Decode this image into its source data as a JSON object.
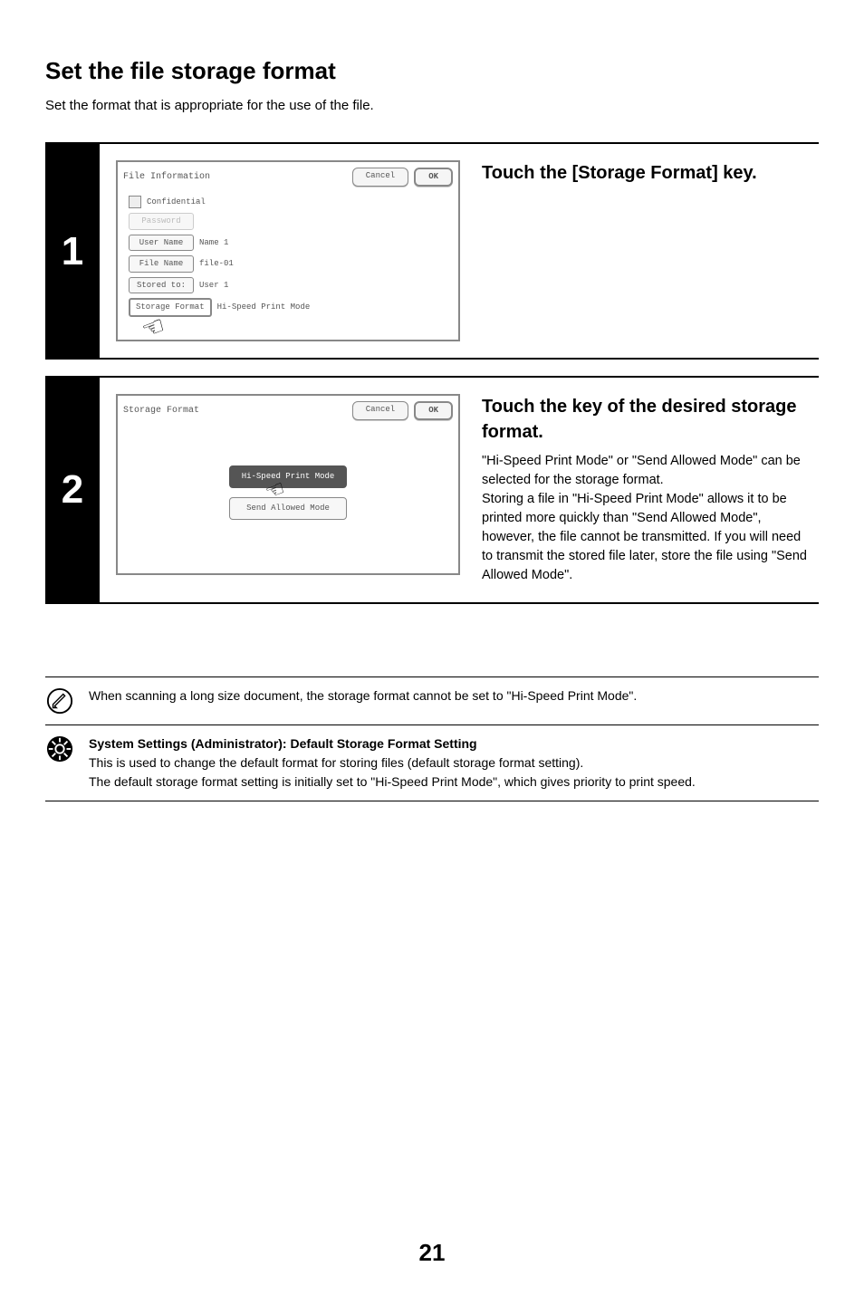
{
  "page": {
    "title": "Set the file storage format",
    "intro": "Set the format that is appropriate for the use of the file.",
    "number": "21"
  },
  "step1": {
    "num": "1",
    "heading": "Touch the [Storage Format] key.",
    "panel": {
      "title": "File Information",
      "cancel": "Cancel",
      "ok": "OK",
      "confidential": "Confidential",
      "password": "Password",
      "username_label": "User Name",
      "username_value": "Name 1",
      "filename_label": "File Name",
      "filename_value": "file-01",
      "storedto_label": "Stored to:",
      "storedto_value": "User 1",
      "storageformat_label": "Storage Format",
      "storageformat_value": "Hi-Speed Print Mode"
    }
  },
  "step2": {
    "num": "2",
    "heading": "Touch the key of the desired storage format.",
    "body": "\"Hi-Speed Print Mode\" or \"Send Allowed Mode\" can be selected for the storage format.\nStoring a file in \"Hi-Speed Print Mode\" allows it to be printed more quickly than \"Send Allowed Mode\", however, the file cannot be transmitted. If you will need to transmit the stored file later, store the file using \"Send Allowed Mode\".",
    "panel": {
      "title": "Storage Format",
      "cancel": "Cancel",
      "ok": "OK",
      "mode_hispeed": "Hi-Speed Print Mode",
      "mode_send": "Send Allowed Mode"
    }
  },
  "notes": {
    "pencil": "When scanning a long size document, the storage format cannot be set to \"Hi-Speed Print Mode\".",
    "gear_title": "System Settings (Administrator): Default Storage Format Setting",
    "gear_line1": "This is used to change the default format for storing files (default storage format setting).",
    "gear_line2": "The default storage format setting is initially set to \"Hi-Speed Print Mode\", which gives priority to print speed."
  }
}
